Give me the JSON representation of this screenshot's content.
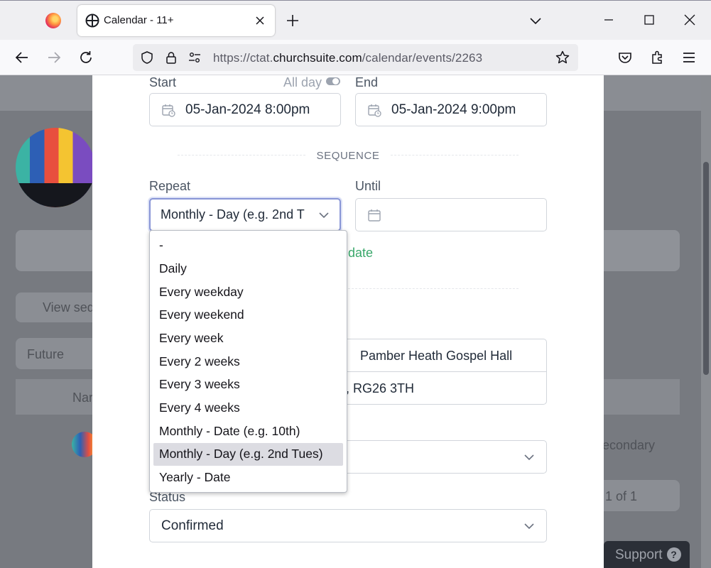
{
  "browser": {
    "tab_title": "Calendar - 11+",
    "url_prefix": "https://ctat.",
    "url_domain": "churchsuite.com",
    "url_path": "/calendar/events/2263"
  },
  "background": {
    "sequence_button": "View seq",
    "filter_value": "Future",
    "column_header": "Nar",
    "secondary_text": "econdary",
    "pagination": "1 of 1",
    "support_label": "Support"
  },
  "modal": {
    "start_label": "Start",
    "all_day_label": "All day",
    "end_label": "End",
    "start_value": "05-Jan-2024 8:00pm",
    "end_value": "05-Jan-2024  9:00pm",
    "sequence_heading": "SEQUENCE",
    "repeat_label": "Repeat",
    "repeat_value": "Monthly - Day (e.g. 2nd T",
    "until_label": "Until",
    "until_value": "",
    "date_link": "date",
    "location_name": "Pamber Heath Gospel Hall",
    "location_address": ", RG26 3TH",
    "status_label": "Status",
    "status_value": "Confirmed"
  },
  "repeat_options": [
    "-",
    "Daily",
    "Every weekday",
    "Every weekend",
    "Every week",
    "Every 2 weeks",
    "Every 3 weeks",
    "Every 4 weeks",
    "Monthly - Date (e.g. 10th)",
    "Monthly - Day (e.g. 2nd Tues)",
    "Yearly - Date"
  ],
  "selected_option": "Monthly - Day (e.g. 2nd Tues)",
  "colors": {
    "accent_green": "#3aa86b",
    "focus_ring": "#8895d6",
    "selected_bg": "#dcdce2"
  }
}
